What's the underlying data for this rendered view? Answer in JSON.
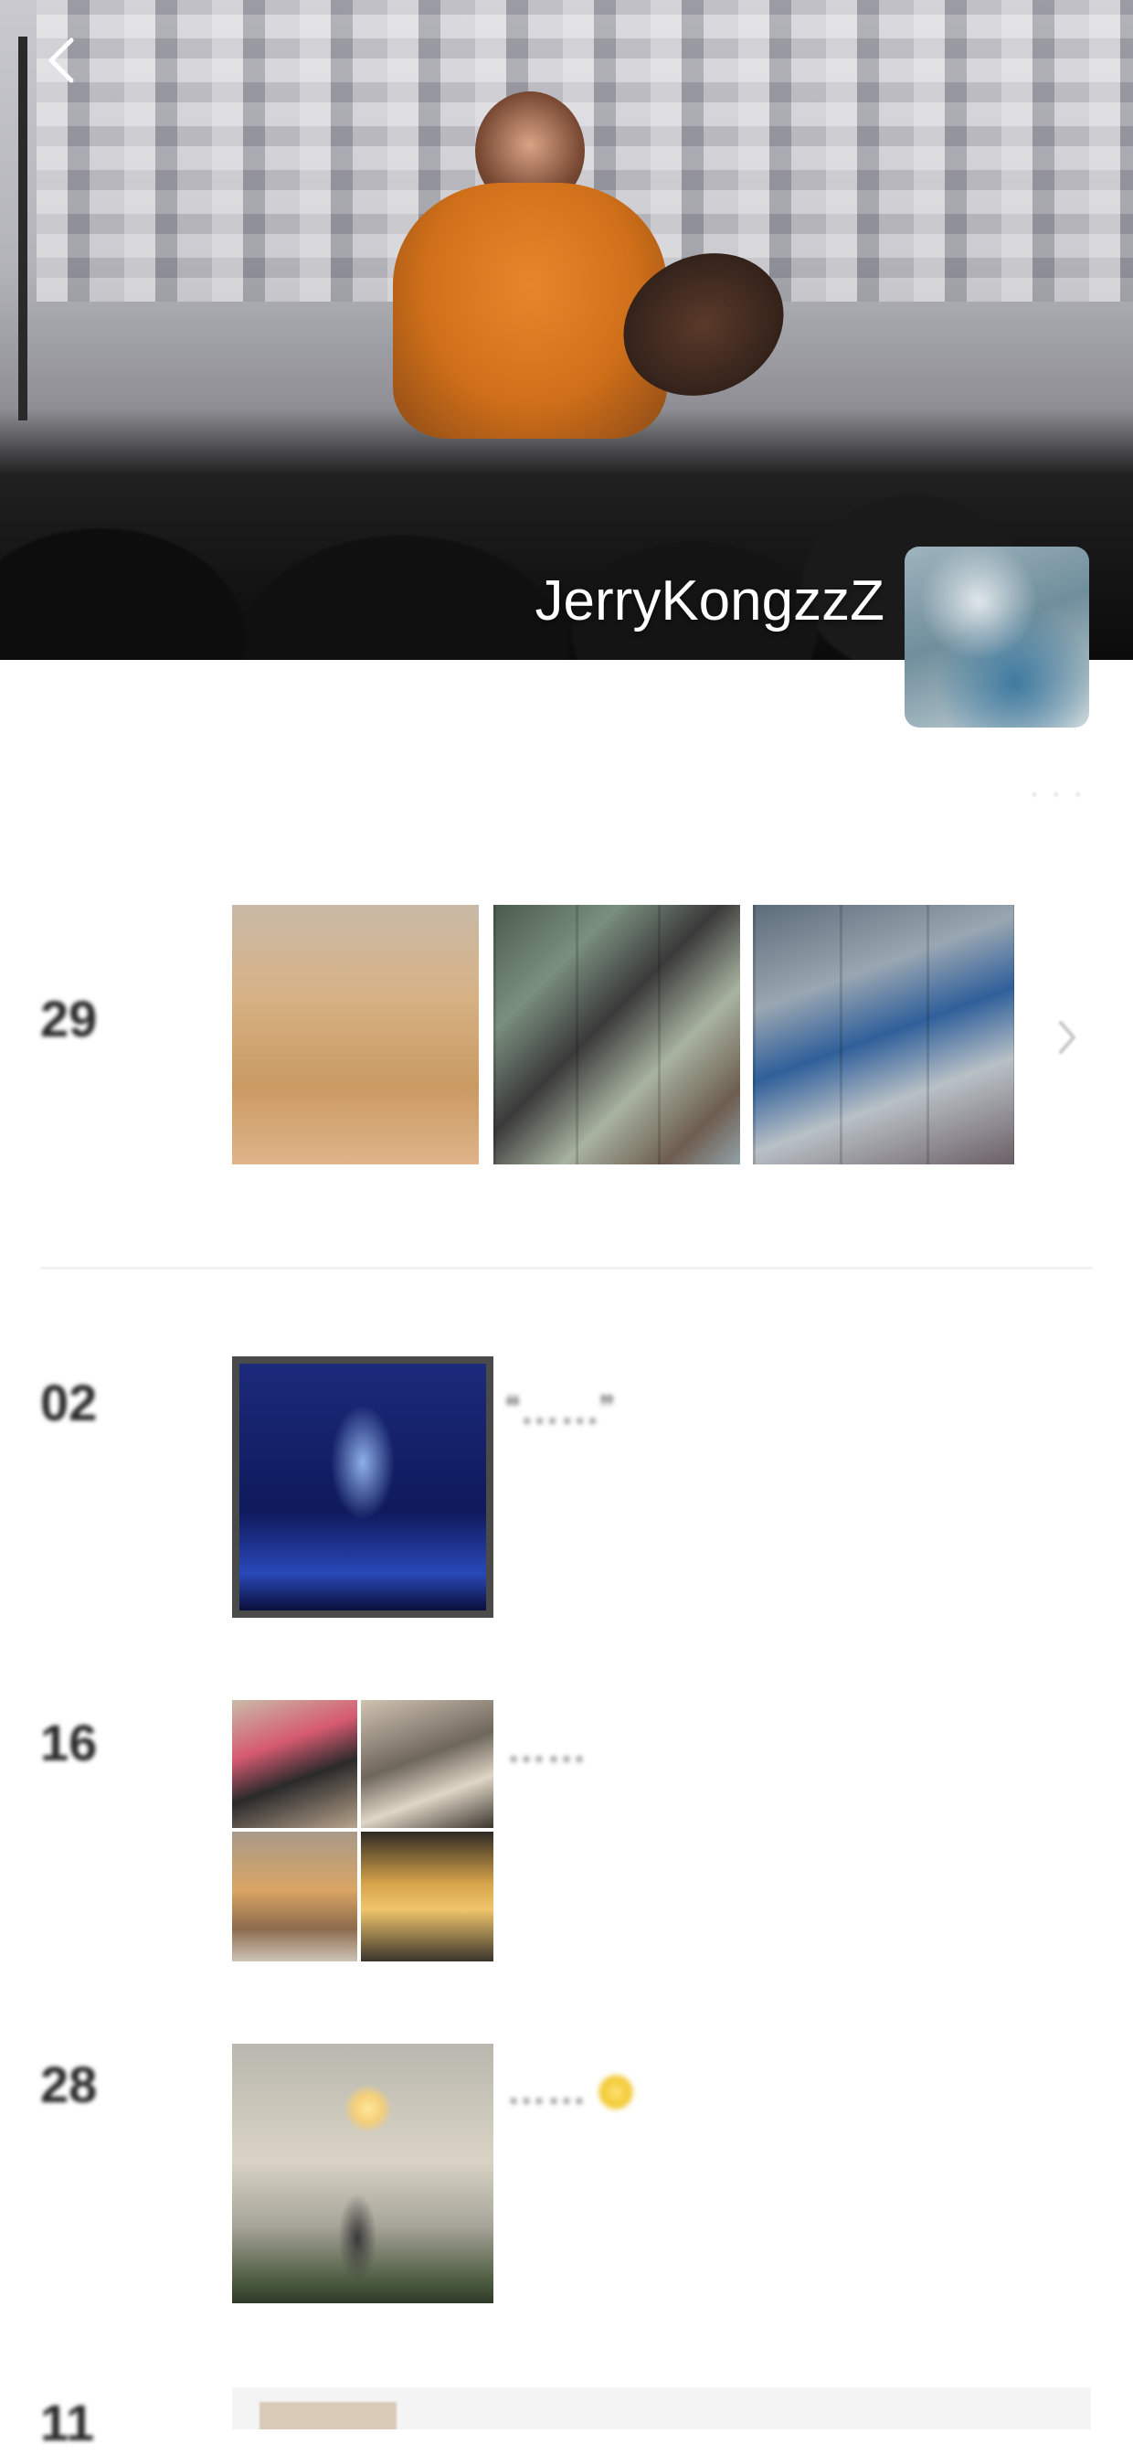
{
  "profile": {
    "username": "JerryKongzzZ",
    "signature": "· · ·"
  },
  "icons": {
    "back": "chevron-left-icon",
    "more": "chevron-right-icon",
    "sparkle": "sparkle-emoji-icon"
  },
  "timeline": [
    {
      "day": "29",
      "month": "",
      "place": "",
      "text": "",
      "has_album_strip": true
    },
    {
      "day": "02",
      "month": "",
      "place": "",
      "text": "“……”"
    },
    {
      "day": "16",
      "month": "",
      "place": "",
      "text": "……"
    },
    {
      "day": "28",
      "month": "",
      "place": "",
      "text": "……"
    },
    {
      "day": "11",
      "month": "",
      "place": "",
      "text": ""
    }
  ],
  "colors": {
    "background": "#ffffff",
    "username": "#ffffff",
    "text": "#333333",
    "muted": "#b5b5b5"
  }
}
